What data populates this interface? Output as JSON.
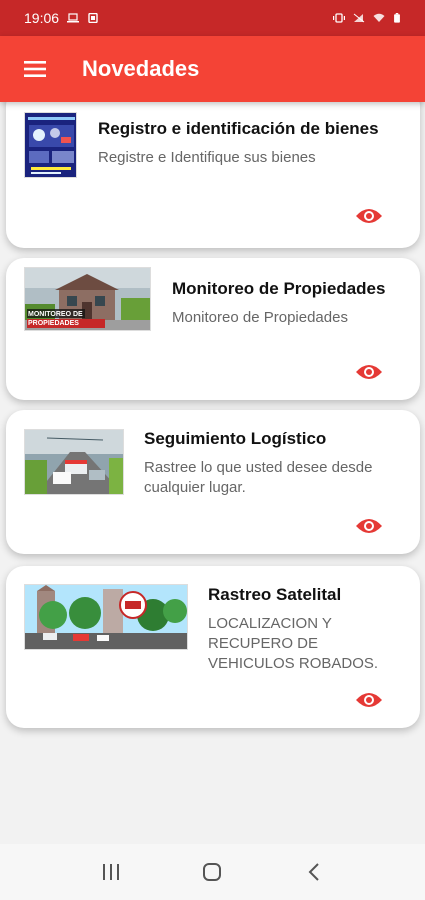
{
  "status_bar": {
    "time": "19:06"
  },
  "app_bar": {
    "title": "Novedades",
    "menu_icon": "hamburger-menu-icon"
  },
  "cards": [
    {
      "title": "Registro e identificación de bienes",
      "description": "Registre e Identifique sus bienes",
      "action_icon": "eye-icon"
    },
    {
      "title": "Monitoreo de Propiedades",
      "description": "Monitoreo de Propiedades",
      "thumb_caption": "MONITOREO DE PROPIEDADES",
      "action_icon": "eye-icon"
    },
    {
      "title": "Seguimiento Logístico",
      "description": "Rastree lo que usted desee desde cualquier lugar.",
      "action_icon": "eye-icon"
    },
    {
      "title": "Rastreo Satelital",
      "description": "LOCALIZACION Y RECUPERO DE VEHICULOS ROBADOS.",
      "action_icon": "eye-icon"
    }
  ],
  "nav_bar": {
    "recents_icon": "recents-icon",
    "home_icon": "home-icon",
    "back_icon": "back-icon"
  },
  "colors": {
    "status_bar": "#c62828",
    "app_bar": "#f44336",
    "accent": "#e53935"
  }
}
